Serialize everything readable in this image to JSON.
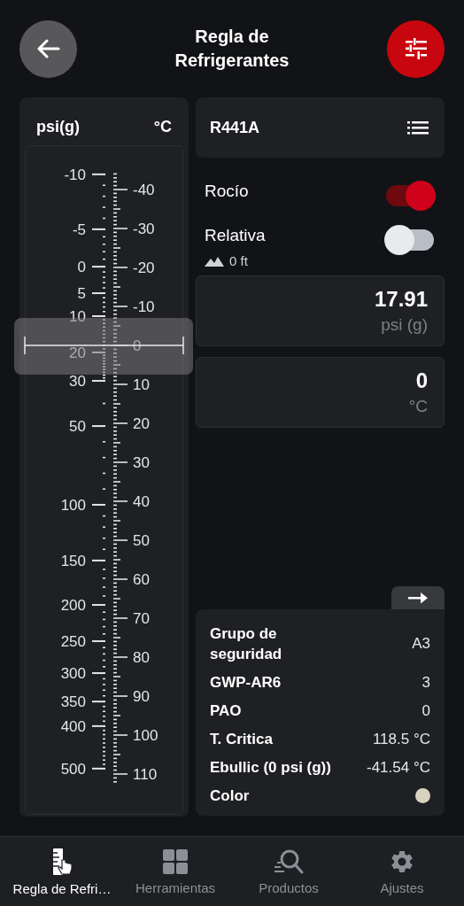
{
  "header": {
    "title": "Regla de Refrigerantes"
  },
  "ruler": {
    "pressure_unit": "psi(g)",
    "temp_unit": "°C",
    "pressure_labels": [
      "-10",
      "-5",
      "0",
      "5",
      "10",
      "20",
      "30",
      "50",
      "100",
      "150",
      "200",
      "250",
      "300",
      "350",
      "400",
      "500"
    ],
    "temp_labels": [
      "-40",
      "-30",
      "-20",
      "-10",
      "0",
      "10",
      "20",
      "30",
      "40",
      "50",
      "60",
      "70",
      "80",
      "90",
      "100",
      "110"
    ]
  },
  "refrigerant": {
    "name": "R441A"
  },
  "toggles": [
    {
      "label": "Rocío",
      "on": true
    },
    {
      "label": "Relativa",
      "on": false,
      "altitude": "0 ft"
    }
  ],
  "readings": [
    {
      "value": "17.91",
      "unit": "psi (g)"
    },
    {
      "value": "0",
      "unit": "°C"
    }
  ],
  "properties": [
    {
      "kind": "text",
      "label": "Grupo de seguridad",
      "value": "A3"
    },
    {
      "kind": "text",
      "label": "GWP-AR6",
      "value": "3"
    },
    {
      "kind": "text",
      "label": "PAO",
      "value": "0"
    },
    {
      "kind": "text",
      "label": "T. Critica",
      "value": "118.5 °C"
    },
    {
      "kind": "text",
      "label": "Ebullic (0 psi (g))",
      "value": "-41.54 °C"
    },
    {
      "kind": "swatch",
      "label": "Color",
      "color": "#d8d2c0"
    }
  ],
  "nav": [
    {
      "label": "Regla de Refri…",
      "selected": true
    },
    {
      "label": "Herramientas",
      "selected": false
    },
    {
      "label": "Productos",
      "selected": false
    },
    {
      "label": "Ajustes",
      "selected": false
    }
  ]
}
